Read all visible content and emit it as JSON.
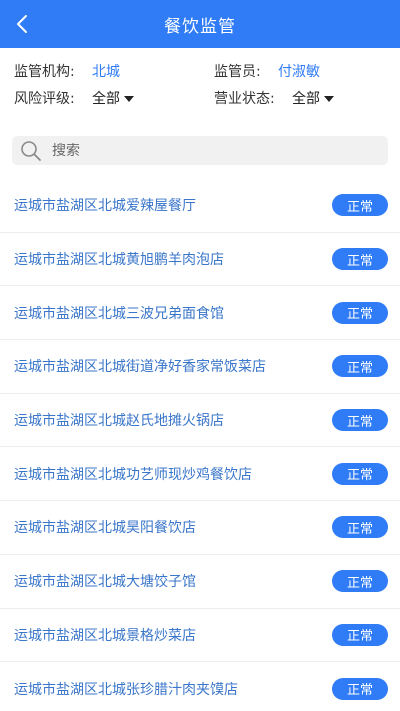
{
  "header": {
    "title": "餐饮监管",
    "back_icon": "chevron-left-icon"
  },
  "filters": {
    "agency_label": "监管机构:",
    "agency_value": "北城",
    "inspector_label": "监管员:",
    "inspector_value": "付淑敏",
    "risk_label": "风险评级:",
    "risk_value": "全部",
    "status_label": "营业状态:",
    "status_value": "全部"
  },
  "search": {
    "placeholder": "搜索",
    "icon": "search-icon"
  },
  "list": [
    {
      "name": "运城市盐湖区北城爱辣屋餐厅",
      "status": "正常"
    },
    {
      "name": "运城市盐湖区北城黄旭鹏羊肉泡店",
      "status": "正常"
    },
    {
      "name": "运城市盐湖区北城三波兄弟面食馆",
      "status": "正常"
    },
    {
      "name": "运城市盐湖区北城街道净好香家常饭菜店",
      "status": "正常"
    },
    {
      "name": "运城市盐湖区北城赵氏地摊火锅店",
      "status": "正常"
    },
    {
      "name": "运城市盐湖区北城功艺师现炒鸡餐饮店",
      "status": "正常"
    },
    {
      "name": "运城市盐湖区北城昊阳餐饮店",
      "status": "正常"
    },
    {
      "name": "运城市盐湖区北城大塘饺子馆",
      "status": "正常"
    },
    {
      "name": "运城市盐湖区北城景格炒菜店",
      "status": "正常"
    },
    {
      "name": "运城市盐湖区北城张珍腊汁肉夹馍店",
      "status": "正常"
    }
  ],
  "colors": {
    "primary": "#2f7cf6",
    "link_text": "#3a76c9",
    "search_bg": "#f1f1f1"
  }
}
